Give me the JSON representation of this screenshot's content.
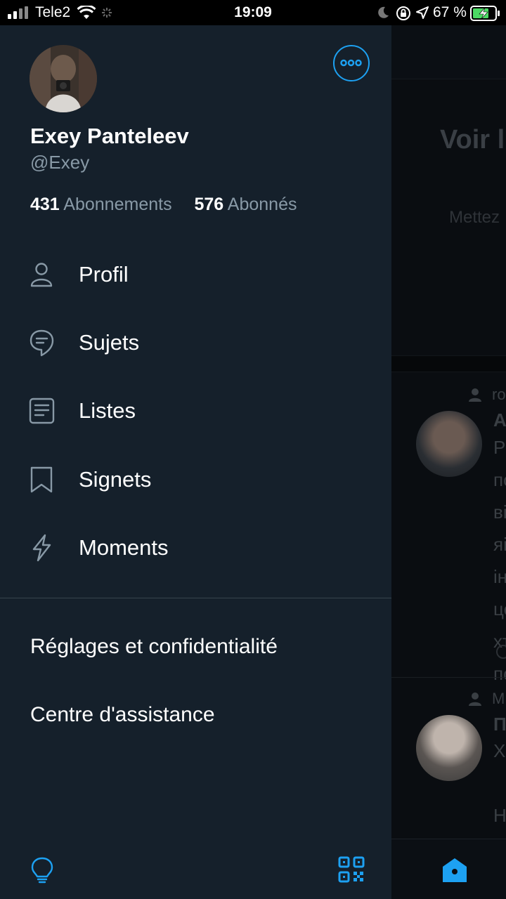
{
  "status_bar": {
    "carrier": "Tele2",
    "time": "19:09",
    "battery": "67 %"
  },
  "profile": {
    "display_name": "Exey Panteleev",
    "handle": "@Exey",
    "following_count": "431",
    "following_label": "Abonnements",
    "followers_count": "576",
    "followers_label": "Abonnés"
  },
  "menu": {
    "items": [
      {
        "label": "Profil",
        "icon": "person-icon"
      },
      {
        "label": "Sujets",
        "icon": "topics-icon"
      },
      {
        "label": "Listes",
        "icon": "lists-icon"
      },
      {
        "label": "Signets",
        "icon": "bookmark-icon"
      },
      {
        "label": "Moments",
        "icon": "lightning-icon"
      }
    ]
  },
  "settings": {
    "privacy_label": "Réglages et confidentialité",
    "help_label": "Centre d'assistance"
  },
  "bottom": {
    "left_icon": "lightbulb-icon",
    "right_icon": "qr-code-icon"
  },
  "background_feed": {
    "prompt_title": "Voir l",
    "prompt_text": "Mettez",
    "tweet1": {
      "context": "ro",
      "name": "A",
      "lines": "P\nпо\nві\nяі\nін\nце\nхт\nпо"
    },
    "tweet2": {
      "context": "M",
      "name": "П",
      "lines": "Х\n\nН\nЦ"
    }
  },
  "colors": {
    "drawer_bg": "#15202b",
    "accent": "#1da1f2",
    "secondary_text": "#8899a6"
  }
}
